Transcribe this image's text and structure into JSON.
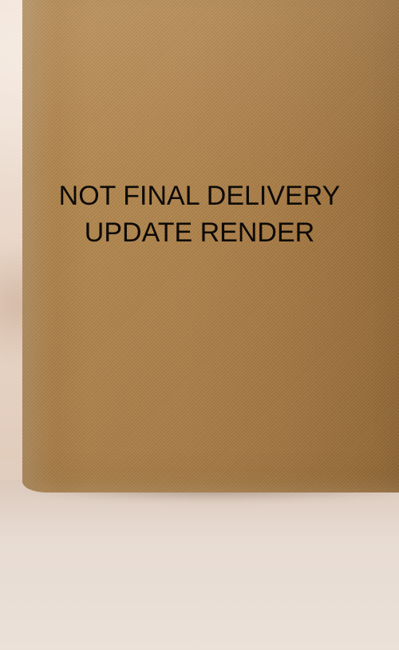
{
  "watermark": {
    "line1": "NOT FINAL DELIVERY",
    "line2": "UPDATE RENDER"
  },
  "scene": {
    "subject": "kraft-paper-tube",
    "colors": {
      "background": "#e9d9cc",
      "tube": "#d2b58a",
      "text": "#0d0a07"
    }
  }
}
